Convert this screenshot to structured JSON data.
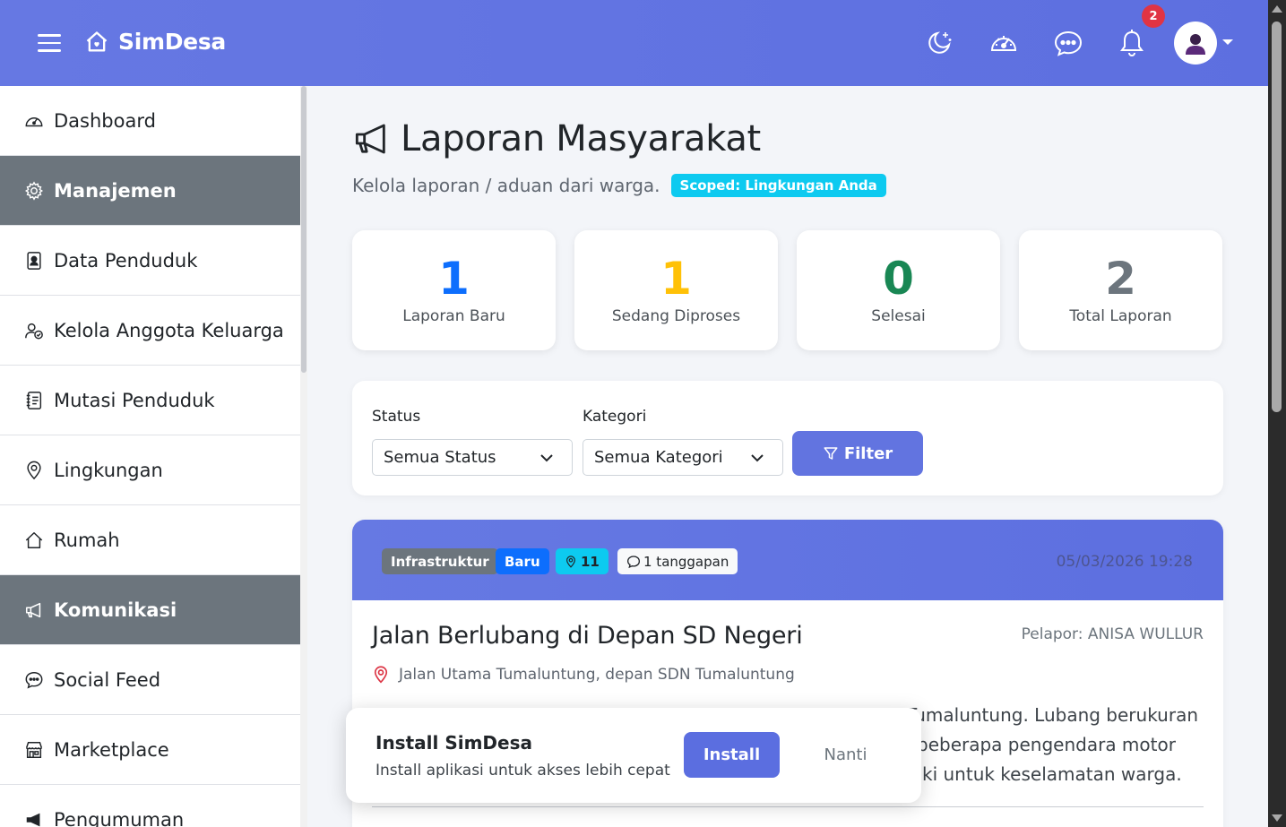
{
  "app": {
    "brand": "SimDesa",
    "notification_count": "2"
  },
  "colors": {
    "primary": "#6274e0",
    "baru": "#0d6efd",
    "diproses": "#ffc107",
    "selesai": "#198754",
    "total": "#6c757d",
    "info": "#0dcaf0",
    "section_bg": "#6c757d",
    "danger": "#e03444"
  },
  "topbar": {
    "icons": [
      "moon-stars-icon",
      "speedometer-icon",
      "chat-dots-icon",
      "bell-icon",
      "user-avatar-icon"
    ]
  },
  "sidebar": {
    "items": [
      {
        "label": "Dashboard",
        "icon": "speedometer-icon",
        "type": "link"
      },
      {
        "label": "Manajemen",
        "icon": "gear-icon",
        "type": "section"
      },
      {
        "label": "Data Penduduk",
        "icon": "person-badge-icon",
        "type": "link"
      },
      {
        "label": "Kelola Anggota Keluarga",
        "icon": "person-check-icon",
        "type": "link"
      },
      {
        "label": "Mutasi Penduduk",
        "icon": "journal-text-icon",
        "type": "link"
      },
      {
        "label": "Lingkungan",
        "icon": "geo-pin-icon",
        "type": "link"
      },
      {
        "label": "Rumah",
        "icon": "house-icon",
        "type": "link"
      },
      {
        "label": "Komunikasi",
        "icon": "megaphone-icon",
        "type": "section"
      },
      {
        "label": "Social Feed",
        "icon": "chat-dots-icon",
        "type": "link"
      },
      {
        "label": "Marketplace",
        "icon": "shop-icon",
        "type": "link"
      },
      {
        "label": "Pengumuman",
        "icon": "megaphone-fill-icon",
        "type": "link"
      }
    ]
  },
  "page": {
    "title": "Laporan Masyarakat",
    "subtitle": "Kelola laporan / aduan dari warga.",
    "scope_badge": "Scoped: Lingkungan Anda"
  },
  "stats": [
    {
      "value": "1",
      "label": "Laporan Baru"
    },
    {
      "value": "1",
      "label": "Sedang Diproses"
    },
    {
      "value": "0",
      "label": "Selesai"
    },
    {
      "value": "2",
      "label": "Total Laporan"
    }
  ],
  "filter": {
    "status_label": "Status",
    "status_value": "Semua Status",
    "kategori_label": "Kategori",
    "kategori_value": "Semua Kategori",
    "button_label": "Filter"
  },
  "report": {
    "category": "Infrastruktur",
    "status": "Baru",
    "location_count": "11",
    "responses": "1 tanggapan",
    "date": "05/03/2026 19:28",
    "title": "Jalan Berlubang di Depan SD Negeri",
    "reporter": "Pelapor: ANISA WULLUR",
    "location": "Jalan Utama Tumaluntung, depan SDN Tumaluntung",
    "body_line1": "Tumaluntung. Lubang berukuran",
    "body_line2": "beberapa pengendara motor",
    "body_line3": "ki untuk keselamatan warga."
  },
  "install_prompt": {
    "title": "Install SimDesa",
    "subtitle": "Install aplikasi untuk akses lebih cepat",
    "install_label": "Install",
    "later_label": "Nanti"
  }
}
